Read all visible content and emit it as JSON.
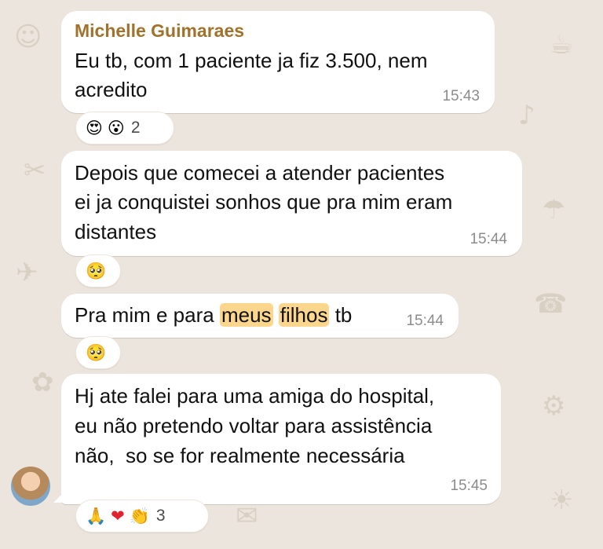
{
  "chat": {
    "messages": [
      {
        "sender": "Michelle Guimaraes",
        "lines": [
          "Eu tb, com 1 paciente ja fiz 3.500, nem",
          "acredito"
        ],
        "time": "15:43",
        "reactions": [
          "heart-eyes-emoji",
          "surprised-emoji"
        ],
        "reaction_count": "2"
      },
      {
        "lines": [
          "Depois que comecei a atender pacientes",
          "ei ja conquistei sonhos que pra mim eram",
          "distantes"
        ],
        "time": "15:44",
        "reactions": [
          "pleading-face-emoji"
        ]
      },
      {
        "parts": {
          "before": "Pra mim e para ",
          "highlight1": "meus",
          "space": " ",
          "highlight2": "filhos",
          "after": " tb"
        },
        "time": "15:44",
        "reactions": [
          "pleading-face-emoji"
        ]
      },
      {
        "lines": [
          "Hj ate falei para uma amiga do hospital,",
          "eu não pretendo voltar para assistência",
          "não,  so se for realmente necessária"
        ],
        "time": "15:45",
        "reactions": [
          "folded-hands-emoji",
          "red-heart-emoji",
          "clapping-hands-emoji"
        ],
        "reaction_count": "3"
      }
    ],
    "colors": {
      "background": "#ece5dd",
      "bubble": "#ffffff",
      "sender_name": "#a0722c",
      "highlight": "#fcd68c",
      "timestamp": "#8c8c8c"
    }
  }
}
